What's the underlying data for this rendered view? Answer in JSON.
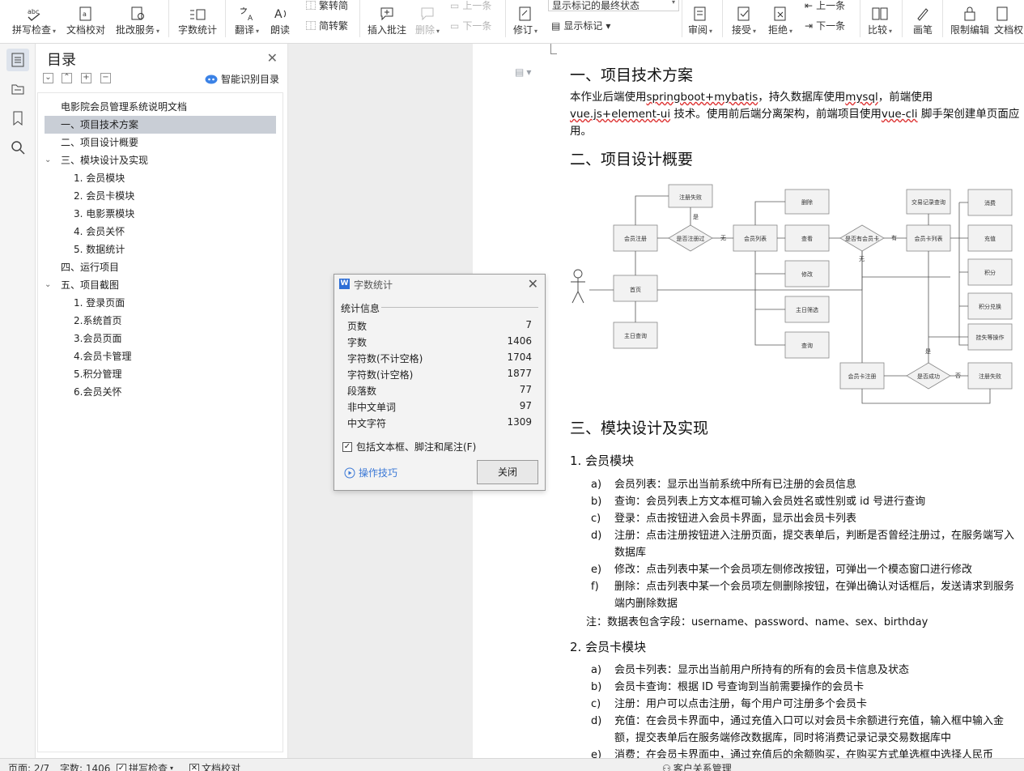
{
  "ribbon": {
    "spell_check": "拼写检查",
    "doc_proof": "文档校对",
    "review_service": "批改服务",
    "word_count": "字数统计",
    "translate": "翻译",
    "read_aloud": "朗读",
    "trad_to_simp": "繁转简",
    "simp_to_trad": "简转繁",
    "insert_comment": "插入批注",
    "delete": "删除",
    "prev_comment": "上一条",
    "next_comment": "下一条",
    "revise": "修订",
    "markup_state": "显示标记的最终状态",
    "show_markup": "显示标记",
    "review": "审阅",
    "accept": "接受",
    "reject": "拒绝",
    "prev_change": "上一条",
    "next_change": "下一条",
    "compare": "比较",
    "ink": "画笔",
    "restrict_edit": "限制编辑",
    "doc_rights": "文档权"
  },
  "toc": {
    "title": "目录",
    "smart_label": "智能识别目录",
    "items": [
      "电影院会员管理系统说明文档",
      "一、项目技术方案",
      "二、项目设计概要",
      "三、模块设计及实现",
      "1.  会员模块",
      "2.  会员卡模块",
      "3.  电影票模块",
      "4.  会员关怀",
      "5.  数据统计",
      "四、运行项目",
      "五、项目截图",
      "1.  登录页面",
      "2.系统首页",
      "3.会员页面",
      "4.会员卡管理",
      "5.积分管理",
      "6.会员关怀"
    ]
  },
  "dialog": {
    "title": "字数统计",
    "section": "统计信息",
    "rows": [
      {
        "k": "页数",
        "v": "7"
      },
      {
        "k": "字数",
        "v": "1406"
      },
      {
        "k": "字符数(不计空格)",
        "v": "1704"
      },
      {
        "k": "字符数(计空格)",
        "v": "1877"
      },
      {
        "k": "段落数",
        "v": "77"
      },
      {
        "k": "非中文单词",
        "v": "97"
      },
      {
        "k": "中文字符",
        "v": "1309"
      }
    ],
    "include_label": "包括文本框、脚注和尾注(F)",
    "include_checked": true,
    "tips": "操作技巧",
    "close": "关闭"
  },
  "doc": {
    "h1": "一、项目技术方案",
    "p1a": "本作业后端使用",
    "p1b": "springboot+mybatis",
    "p1c": "，持久数据库使用",
    "p1d": "mysql",
    "p1e": "，前端使用",
    "p1f": "vue.js+element-ui",
    "p1g": " 技术。使用前后端分离架构，前端项目使用",
    "p1h": "vue-cli",
    "p1i": " 脚手架创建单页面应用。",
    "h2": "二、项目设计概要",
    "h3": "三、模块设计及实现",
    "s1": "1.  会员模块",
    "s1_items": [
      {
        "m": "a)",
        "t": "会员列表：显示出当前系统中所有已注册的会员信息"
      },
      {
        "m": "b)",
        "t": "查询：会员列表上方文本框可输入会员姓名或性别或 id 号进行查询"
      },
      {
        "m": "c)",
        "t": "登录：点击按钮进入会员卡界面，显示出会员卡列表"
      },
      {
        "m": "d)",
        "t": "注册：点击注册按钮进入注册页面，提交表单后，判断是否曾经注册过，在服务端写入数据库"
      },
      {
        "m": "e)",
        "t": "修改：点击列表中某一个会员项左侧修改按钮，可弹出一个模态窗口进行修改"
      },
      {
        "m": "f)",
        "t": "删除：点击列表中某一个会员项左侧删除按钮，在弹出确认对话框后，发送请求到服务端内删除数据"
      }
    ],
    "note": "注：数据表包含字段：username、password、name、sex、birthday",
    "s2": "2.  会员卡模块",
    "s2_items": [
      {
        "m": "a)",
        "t": "会员卡列表：显示出当前用户所持有的所有的会员卡信息及状态"
      },
      {
        "m": "b)",
        "t": "会员卡查询：根据 ID 号查询到当前需要操作的会员卡"
      },
      {
        "m": "c)",
        "t": "注册：用户可以点击注册，每个用户可注册多个会员卡"
      },
      {
        "m": "d)",
        "t": "充值：在会员卡界面中，通过充值入口可以对会员卡余额进行充值，输入框中输入金额，提交表单后在服务端修改数据库，同时将消费记录记录交易数据库中"
      },
      {
        "m": "e)",
        "t": "消费：在会员卡界面中，通过充值后的余额购买，在购买方式单选框中选择人民币"
      }
    ]
  },
  "diagram": {
    "nodes": {
      "fail_register": "注册失败",
      "member_register": "会员注册",
      "registered_q": "是否注册过",
      "no": "无",
      "member_list": "会员列表",
      "delete": "删除",
      "view": "查看",
      "modify": "修改",
      "query": "查询",
      "home": "首页",
      "theme_query": "主日查询",
      "theme_filter": "主日筛选",
      "has_card_q": "是否有会员卡",
      "yes": "有",
      "none": "无",
      "card_list": "会员卡列表",
      "tx_query": "交易记录查询",
      "consume": "消费",
      "recharge": "充值",
      "points": "积分",
      "points_exchange": "积分兑换",
      "report_loss": "挂失等操作",
      "card_register": "会员卡注册",
      "success_q": "是否成功",
      "no2": "否",
      "fail2": "注册失败",
      "yes2": "是",
      "yes3": "是"
    }
  },
  "status": {
    "page": "页面: 2/7",
    "words": "字数: 1406",
    "spell": "拼写检查",
    "proof": "文档校对",
    "crm": "客户关系管理"
  }
}
